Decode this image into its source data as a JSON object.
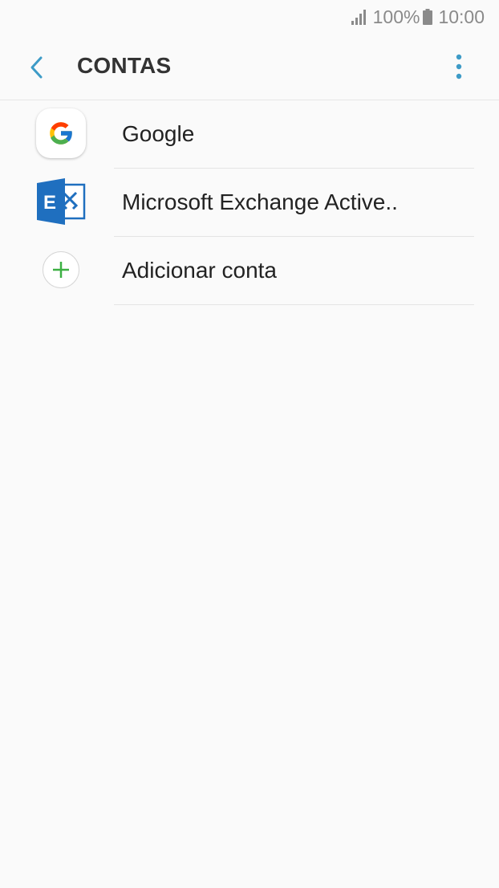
{
  "status_bar": {
    "battery_percent": "100%",
    "time": "10:00",
    "icons": [
      "signal-icon",
      "battery-icon"
    ]
  },
  "header": {
    "title": "CONTAS",
    "back_icon": "back-arrow-icon",
    "more_icon": "more-options-icon"
  },
  "accounts": {
    "items": [
      {
        "label": "Google",
        "icon": "google-icon"
      },
      {
        "label": "Microsoft Exchange Active..",
        "icon": "exchange-icon"
      },
      {
        "label": "Adicionar conta",
        "icon": "add-icon"
      }
    ]
  },
  "colors": {
    "background": "#fafafa",
    "accent": "#3d9bc7",
    "add_green": "#3cb043",
    "exchange_blue": "#1f6fbf"
  }
}
